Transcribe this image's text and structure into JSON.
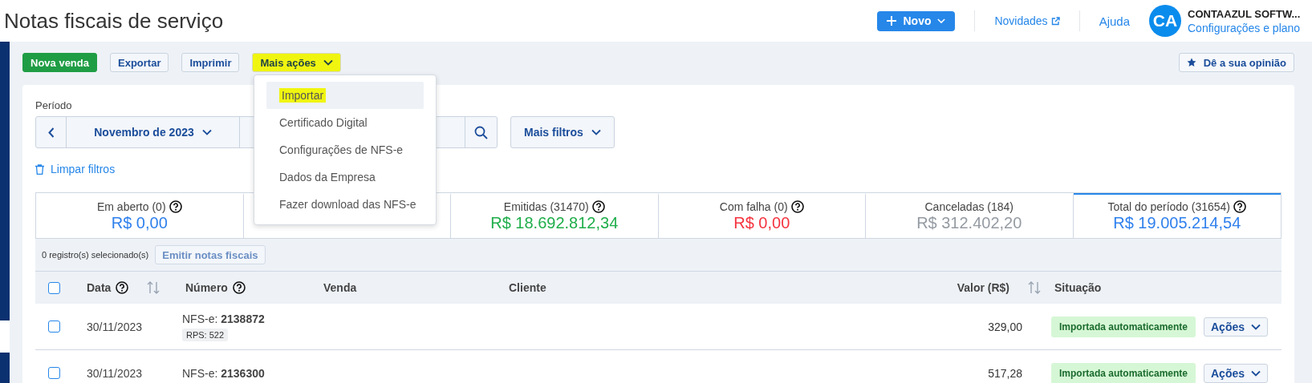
{
  "header": {
    "title": "Notas fiscais de serviço",
    "new_button": "Novo",
    "links": [
      {
        "label": "Novidades",
        "external": true
      },
      {
        "label": "Ajuda",
        "external": false
      }
    ],
    "user": {
      "initials": "CA",
      "name": "CONTAAZUL SOFTW...",
      "link": "Configurações e plano"
    }
  },
  "toolbar": {
    "buttons": [
      {
        "label": "Nova venda",
        "kind": "primary",
        "highlighted": false
      },
      {
        "label": "Exportar",
        "kind": "outline",
        "highlighted": false
      },
      {
        "label": "Imprimir",
        "kind": "outline",
        "highlighted": false
      },
      {
        "label": "Mais ações",
        "kind": "dropdown",
        "highlighted": true
      }
    ],
    "feedback": "Dê a sua opinião"
  },
  "menu": {
    "items": [
      {
        "label": "Importar",
        "selected": true,
        "highlighted": true
      },
      {
        "label": "Certificado Digital",
        "selected": false,
        "highlighted": false
      },
      {
        "label": "Configurações de NFS-e",
        "selected": false,
        "highlighted": false
      },
      {
        "label": "Dados da Empresa",
        "selected": false,
        "highlighted": false
      },
      {
        "label": "Fazer download das NFS-e",
        "selected": false,
        "highlighted": false
      }
    ]
  },
  "filters": {
    "period_label": "Período",
    "period_value": "Novembro de 2023",
    "more_filters": "Mais filtros",
    "clear": "Limpar filtros"
  },
  "cards": [
    {
      "label": "Em aberto (0)",
      "value": "R$ 0,00",
      "color": "#2f80ed",
      "help": true,
      "selected": false
    },
    {
      "selected": false
    },
    {
      "label": "Emitidas (31470)",
      "value": "R$ 18.692.812,34",
      "color": "#1fae4b",
      "help": true,
      "selected": false
    },
    {
      "label": "Com falha (0)",
      "value": "R$ 0,00",
      "color": "#f5333f",
      "help": true,
      "selected": false
    },
    {
      "label": "Canceladas (184)",
      "value": "R$ 312.402,20",
      "color": "#959ba3",
      "help": false,
      "selected": false
    },
    {
      "label": "Total do período (31654)",
      "value": "R$ 19.005.214,54",
      "color": "#2f80ed",
      "help": true,
      "selected": true
    }
  ],
  "selection": {
    "count": "0 registro(s) selecionado(s)",
    "button": "Emitir notas fiscais"
  },
  "table": {
    "select_all": {
      "checked": false
    },
    "columns": [
      {
        "label": "Data",
        "help": true,
        "sortable": true
      },
      {
        "label": "Número",
        "help": true,
        "sortable": false
      },
      {
        "label": "Venda",
        "help": false,
        "sortable": false
      },
      {
        "label": "Cliente",
        "help": false,
        "sortable": false
      },
      {
        "label": "Valor (R$)",
        "help": false,
        "sortable": true
      },
      {
        "label": "Situação",
        "help": false,
        "sortable": false
      }
    ],
    "rows": [
      {
        "checked": false,
        "date": "30/11/2023",
        "number_prefix": "NFS-e:",
        "number": "2138872",
        "rps": "RPS: 522",
        "value": "329,00",
        "status": "Importada automaticamente",
        "action": "Ações"
      },
      {
        "checked": false,
        "date": "30/11/2023",
        "number_prefix": "NFS-e:",
        "number": "2136300",
        "value": "517,28",
        "status": "Importada automaticamente",
        "action": "Ações"
      }
    ]
  }
}
